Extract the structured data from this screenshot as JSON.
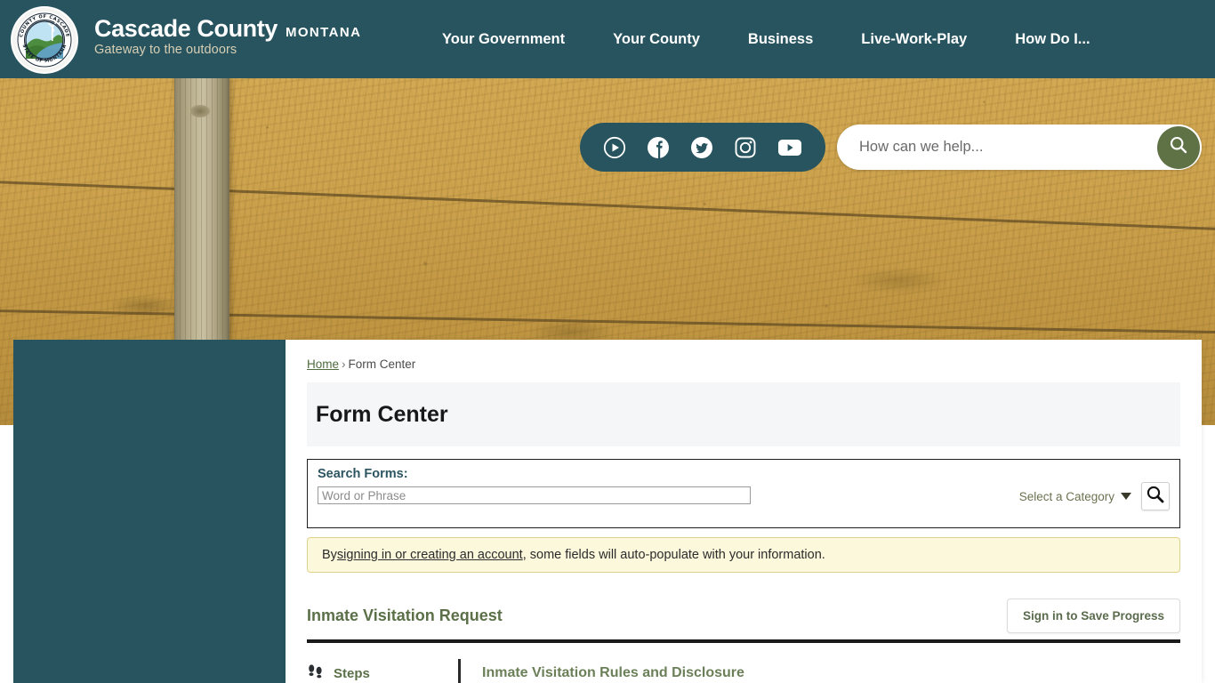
{
  "colors": {
    "header_teal": "#27545f",
    "accent_green": "#5f7246",
    "notice_bg": "#fcf8dc",
    "notice_border": "#e0d28c",
    "title_band": "#f5f6f7"
  },
  "header": {
    "seal_top_text": "COUNTY OF CASCADE",
    "seal_bottom_text": "STATE OF MONTANA",
    "brand_name": "Cascade County",
    "brand_state": "MONTANA",
    "tagline": "Gateway to the outdoors",
    "nav": [
      {
        "label": "Your Government"
      },
      {
        "label": "Your County"
      },
      {
        "label": "Business"
      },
      {
        "label": "Live-Work-Play"
      },
      {
        "label": "How Do I..."
      }
    ]
  },
  "social": {
    "icons": [
      {
        "name": "media-play-icon"
      },
      {
        "name": "facebook-icon"
      },
      {
        "name": "twitter-icon"
      },
      {
        "name": "instagram-icon"
      },
      {
        "name": "youtube-icon"
      }
    ]
  },
  "site_search": {
    "placeholder": "How can we help...",
    "value": "",
    "button_icon": "search-icon"
  },
  "breadcrumb": {
    "home": "Home",
    "separator": "›",
    "current": "Form Center"
  },
  "main": {
    "page_title": "Form Center",
    "search_forms": {
      "label": "Search Forms:",
      "placeholder": "Word or Phrase",
      "value": "",
      "category_label": "Select a Category",
      "submit_icon": "search-icon"
    },
    "notice": {
      "prefix": "By ",
      "link": "signing in or creating an account",
      "suffix": ", some fields will auto-populate with your information."
    },
    "form": {
      "name": "Inmate Visitation Request",
      "save_button": "Sign in to Save Progress",
      "steps_label": "Steps",
      "steps_icon": "footprints-icon",
      "current_step_title": "Inmate Visitation Rules and Disclosure"
    }
  }
}
